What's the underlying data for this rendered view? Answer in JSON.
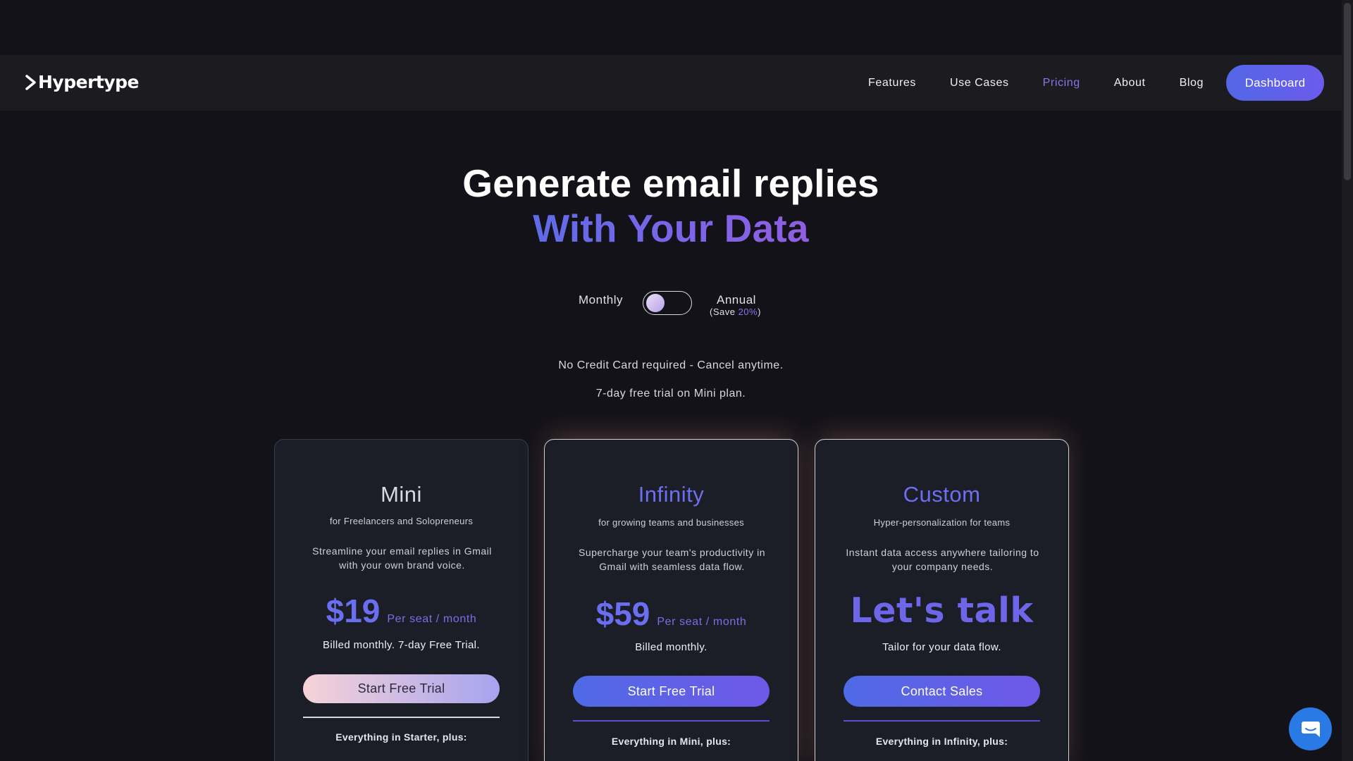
{
  "brand": {
    "name": "Hypertype"
  },
  "nav": {
    "links": [
      "Features",
      "Use Cases",
      "Pricing",
      "About",
      "Blog"
    ],
    "active": "Pricing",
    "dashboard_label": "Dashboard"
  },
  "hero": {
    "title": "Generate email replies",
    "subtitle": "With Your Data"
  },
  "billing": {
    "monthly_label": "Monthly",
    "annual_label": "Annual",
    "save_prefix": "(Save ",
    "save_value": "20%",
    "save_suffix": ")",
    "selected": "Monthly"
  },
  "notes": {
    "line1": "No Credit Card required - Cancel anytime.",
    "line2": "7-day free trial on Mini plan."
  },
  "plans": [
    {
      "name": "Mini",
      "for": "for Freelancers and Solopreneurs",
      "description": "Streamline your email replies in Gmail with your own brand voice.",
      "price": "$19",
      "unit": "Per seat / month",
      "billed": "Billed monthly. 7-day Free Trial.",
      "cta": "Start Free Trial",
      "includes": "Everything in Starter, plus:"
    },
    {
      "name": "Infinity",
      "for": "for growing teams and businesses",
      "description": "Supercharge your team's productivity in Gmail with seamless data flow.",
      "price": "$59",
      "unit": "Per seat / month",
      "billed": "Billed monthly.",
      "cta": "Start Free Trial",
      "includes": "Everything in Mini, plus:"
    },
    {
      "name": "Custom",
      "for": "Hyper-personalization for teams",
      "description": "Instant data access anywhere tailoring to your company needs.",
      "price": "Let's talk",
      "billed": "Tailor for your data flow.",
      "cta": "Contact Sales",
      "includes": "Everything in Infinity, plus:"
    }
  ],
  "icons": {
    "logo": "chevron-right-icon",
    "chat": "chat-bubble-icon"
  },
  "colors": {
    "accent": "#6a6ef0",
    "background": "#131219",
    "nav": "#1c1c20",
    "chat": "#2a7ae6"
  }
}
